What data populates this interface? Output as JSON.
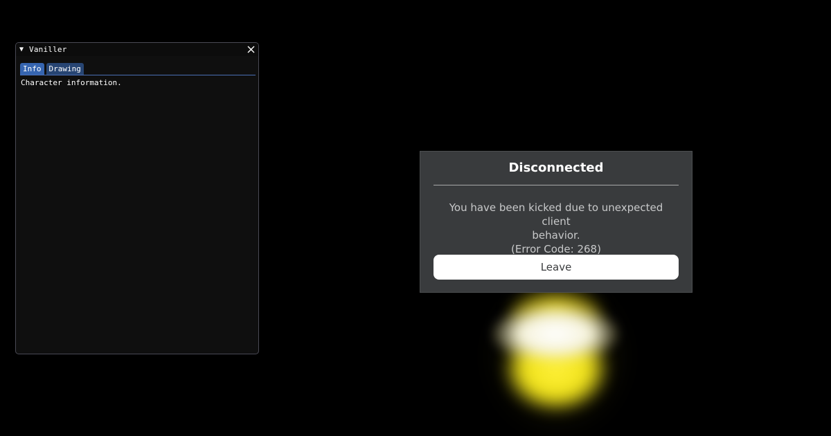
{
  "imgui_window": {
    "title": "Vaniller",
    "collapse_icon": "triangle-down-icon",
    "close_icon": "close-icon",
    "tabs": [
      {
        "label": "Info",
        "active": true
      },
      {
        "label": "Drawing",
        "active": false
      }
    ],
    "content_text": "Character information.",
    "colors": {
      "tab_active": "#3665b0",
      "tab_inactive": "#274573",
      "tab_underline": "#4a6fb5"
    }
  },
  "modal": {
    "title": "Disconnected",
    "message_lines": [
      "You have been kicked due to unexpected client",
      "behavior.",
      "(Error Code: 268)"
    ],
    "leave_label": "Leave"
  }
}
